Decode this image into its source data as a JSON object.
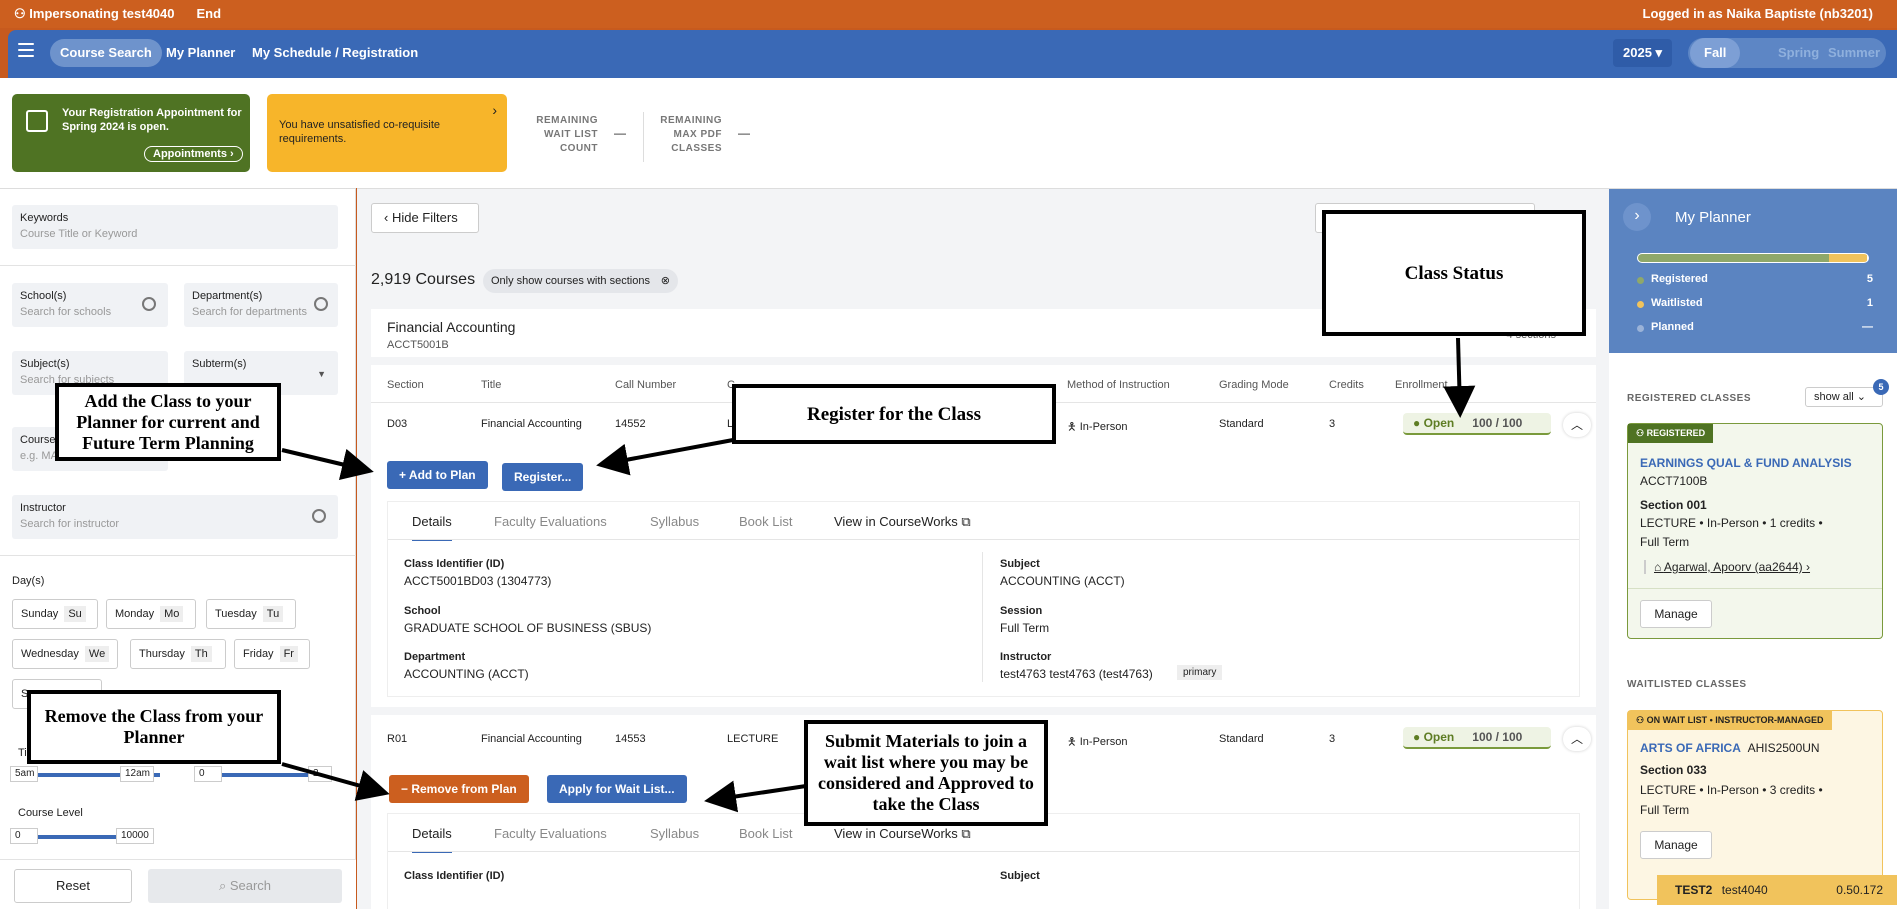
{
  "impersonation": {
    "label": "Impersonating test4040",
    "end": "End",
    "logged_in": "Logged in as Naika Baptiste (nb3201)"
  },
  "nav": {
    "items": [
      "Course Search",
      "My Planner",
      "My Schedule / Registration"
    ],
    "year": "2025 ▾",
    "terms": [
      "Fall",
      "Spring",
      "Summer"
    ]
  },
  "banner": {
    "appointment": "Your Registration Appointment for Spring 2024 is open.",
    "appointments_btn": "Appointments",
    "coreq": "You have unsatisfied co-requisite requirements.",
    "remain_wait_1": "REMAINING",
    "remain_wait_2": "WAIT LIST",
    "remain_wait_3": "COUNT",
    "remain_wait_val": "—",
    "remain_pdf_1": "REMAINING",
    "remain_pdf_2": "MAX PDF",
    "remain_pdf_3": "CLASSES",
    "remain_pdf_val": "—"
  },
  "filters": {
    "keywords_label": "Keywords",
    "keywords_ph": "Course Title or Keyword",
    "schools_label": "School(s)",
    "schools_ph": "Search for schools",
    "departments_label": "Department(s)",
    "departments_ph": "Search for departments",
    "subjects_label": "Subject(s)",
    "subjects_ph": "Search for subjects",
    "subterm_label": "Subterm(s)",
    "course_label": "Course",
    "course_ph": "e.g. MA",
    "instructor_label": "Instructor",
    "instructor_ph": "Search for instructor",
    "days_label": "Day(s)",
    "days": [
      {
        "name": "Sunday",
        "abbr": "Su"
      },
      {
        "name": "Monday",
        "abbr": "Mo"
      },
      {
        "name": "Tuesday",
        "abbr": "Tu"
      },
      {
        "name": "Wednesday",
        "abbr": "We"
      },
      {
        "name": "Thursday",
        "abbr": "Th"
      },
      {
        "name": "Friday",
        "abbr": "Fr"
      },
      {
        "name": "Sa",
        "abbr": ""
      }
    ],
    "time_label": "Ti",
    "time_from": "5am",
    "time_to": "12am",
    "credits_from": "0",
    "credits_to": "2",
    "course_level_label": "Course Level",
    "level_from": "0",
    "level_to": "10000",
    "reset": "Reset",
    "search": "Search"
  },
  "main": {
    "hide_filters": "Hide Filters",
    "course_count": "2,919 Courses",
    "chip": "Only show courses with sections",
    "course_title": "Financial Accounting",
    "course_code": "ACCT5001B",
    "sections_count": "4 sections",
    "headers": [
      "Section",
      "Title",
      "Call Number",
      "C",
      "Method of Instruction",
      "Grading Mode",
      "Credits",
      "Enrollment"
    ],
    "rows": [
      {
        "section": "D03",
        "title": "Financial Accounting",
        "call": "14552",
        "comp": "L",
        "method": "In-Person",
        "grading": "Standard",
        "credits": "3",
        "status": "Open",
        "enroll": "100 / 100"
      },
      {
        "section": "R01",
        "title": "Financial Accounting",
        "call": "14553",
        "comp": "LECTURE",
        "method": "In-Person",
        "grading": "Standard",
        "credits": "3",
        "status": "Open",
        "enroll": "100 / 100"
      }
    ],
    "add_to_plan": "Add to Plan",
    "register": "Register...",
    "remove_from_plan": "Remove from Plan",
    "apply_wait": "Apply for Wait List...",
    "tabs": [
      "Details",
      "Faculty Evaluations",
      "Syllabus",
      "Book List",
      "View in CourseWorks"
    ],
    "details": {
      "class_id_label": "Class Identifier (ID)",
      "class_id": "ACCT5001BD03 (1304773)",
      "school_label": "School",
      "school": "GRADUATE SCHOOL OF BUSINESS (SBUS)",
      "dept_label": "Department",
      "dept": "ACCOUNTING (ACCT)",
      "subject_label": "Subject",
      "subject": "ACCOUNTING (ACCT)",
      "session_label": "Session",
      "session": "Full Term",
      "instructor_label": "Instructor",
      "instructor": "test4763 test4763 (test4763)",
      "primary": "primary"
    }
  },
  "planner": {
    "title": "My Planner",
    "registered": "Registered",
    "registered_n": "5",
    "waitlisted": "Waitlisted",
    "waitlisted_n": "1",
    "planned": "Planned",
    "planned_n": "—",
    "registered_classes": "REGISTERED CLASSES",
    "show_all": "show all",
    "badge": "5",
    "reg_card": {
      "tag": "REGISTERED",
      "title": "EARNINGS QUAL & FUND ANALYSIS",
      "code": "ACCT7100B",
      "section": "Section 001",
      "info": "LECTURE • In-Person • 1 credits •",
      "term": "Full Term",
      "instructor": "Agarwal, Apoorv (aa2644)",
      "manage": "Manage"
    },
    "waitlisted_classes": "WAITLISTED CLASSES",
    "wait_card": {
      "tag": "ON WAIT LIST • INSTRUCTOR-MANAGED",
      "title": "ARTS OF AFRICA",
      "code": "AHIS2500UN",
      "section": "Section 033",
      "info": "LECTURE • In-Person • 3 credits •",
      "term": "Full Term",
      "manage": "Manage"
    },
    "footer": {
      "env": "TEST2",
      "user": "test4040",
      "version": "0.50.172"
    }
  },
  "annotations": {
    "class_status": "Class Status",
    "register_class": "Register for the Class",
    "add_class": "Add the Class to your Planner for current and Future Term Planning",
    "remove_class": "Remove the Class from your Planner",
    "submit_materials": "Submit Materials to join a wait list where you may be considered and Approved to take the Class"
  },
  "colors": {
    "orange": "#cc5f1f",
    "blue": "#3a69b6",
    "green": "#4f7323",
    "yellow": "#f7b52a"
  }
}
